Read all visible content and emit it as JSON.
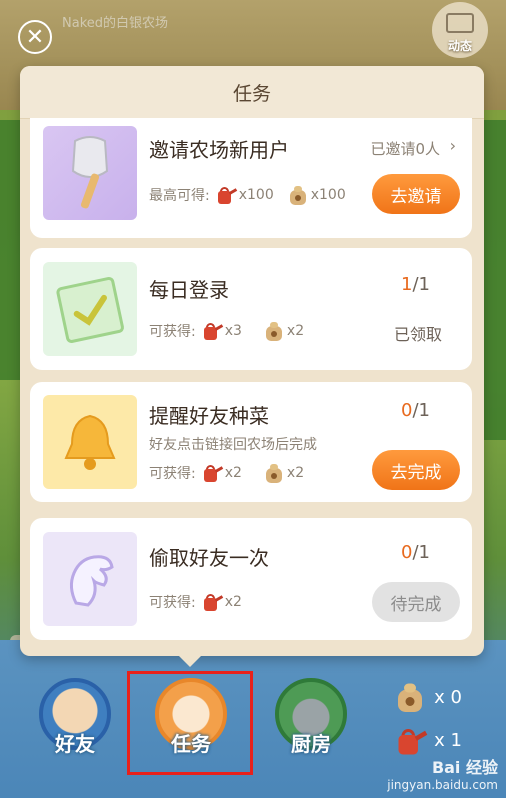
{
  "farm_title": "Naked的白银农场",
  "moments_label": "动态",
  "panel": {
    "title": "任务"
  },
  "tasks": [
    {
      "title": "邀请农场新用户",
      "status": "已邀请0人",
      "reward_label": "最高可得:",
      "rewards": [
        {
          "icon": "watering-can-icon",
          "amount": "x100"
        },
        {
          "icon": "seed-bag-icon",
          "amount": "x100"
        }
      ],
      "button": "去邀请"
    },
    {
      "title": "每日登录",
      "progress_current": "1",
      "progress_total": "/1",
      "reward_label": "可获得:",
      "rewards": [
        {
          "icon": "watering-can-icon",
          "amount": "x3"
        },
        {
          "icon": "seed-bag-icon",
          "amount": "x2"
        }
      ],
      "status": "已领取"
    },
    {
      "title": "提醒好友种菜",
      "subtitle": "好友点击链接回农场后完成",
      "progress_current": "0",
      "progress_total": "/1",
      "reward_label": "可获得:",
      "rewards": [
        {
          "icon": "watering-can-icon",
          "amount": "x2"
        },
        {
          "icon": "seed-bag-icon",
          "amount": "x2"
        }
      ],
      "button": "去完成"
    },
    {
      "title": "偷取好友一次",
      "progress_current": "0",
      "progress_total": "/1",
      "reward_label": "可获得:",
      "rewards": [
        {
          "icon": "watering-can-icon",
          "amount": "x2"
        }
      ],
      "button": "待完成"
    }
  ],
  "nav": {
    "friends": "好友",
    "tasks": "任务",
    "kitchen": "厨房"
  },
  "inventory": {
    "seeds": "x 0",
    "cans": "x 1"
  },
  "watermark": {
    "brand": "Bai 经验",
    "url": "jingyan.baidu.com"
  },
  "colors": {
    "accent_orange": "#f07418",
    "progress_orange": "#e86a1f",
    "highlight_red": "#e8211b"
  }
}
